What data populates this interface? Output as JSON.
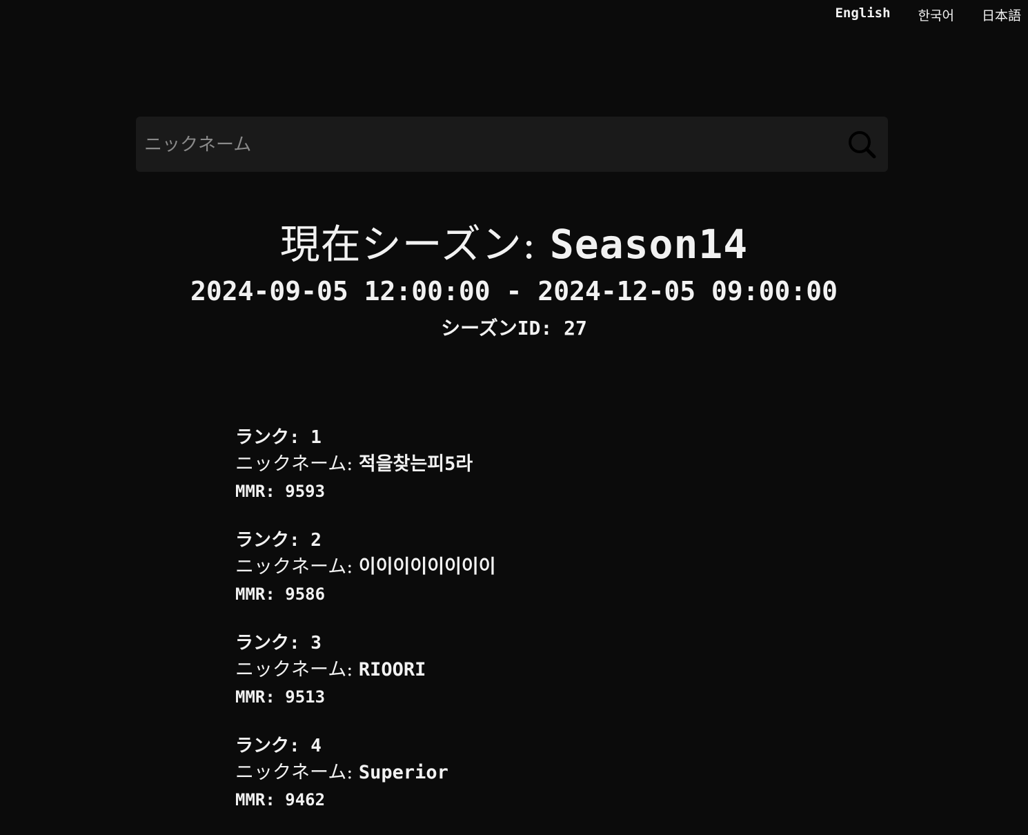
{
  "languages": [
    {
      "label": "English"
    },
    {
      "label": "한국어"
    },
    {
      "label": "日本語"
    }
  ],
  "search": {
    "placeholder": "ニックネーム",
    "value": ""
  },
  "season": {
    "title_prefix": "現在シーズン: ",
    "title_name": "Season14",
    "dates": "2024-09-05 12:00:00 - 2024-12-05 09:00:00",
    "id_line": "シーズンID: 27"
  },
  "ranking": [
    {
      "rank_label": "ランク: 1",
      "nick_label": "ニックネーム: ",
      "nickname": "적을찾는피5라",
      "mmr_label": "MMR: 9593"
    },
    {
      "rank_label": "ランク: 2",
      "nick_label": "ニックネーム: ",
      "nickname": "이이이이이이이이",
      "mmr_label": "MMR: 9586"
    },
    {
      "rank_label": "ランク: 3",
      "nick_label": "ニックネーム: ",
      "nickname": "RIOORI",
      "mmr_label": "MMR: 9513"
    },
    {
      "rank_label": "ランク: 4",
      "nick_label": "ニックネーム: ",
      "nickname": "Superior",
      "mmr_label": "MMR: 9462"
    }
  ]
}
